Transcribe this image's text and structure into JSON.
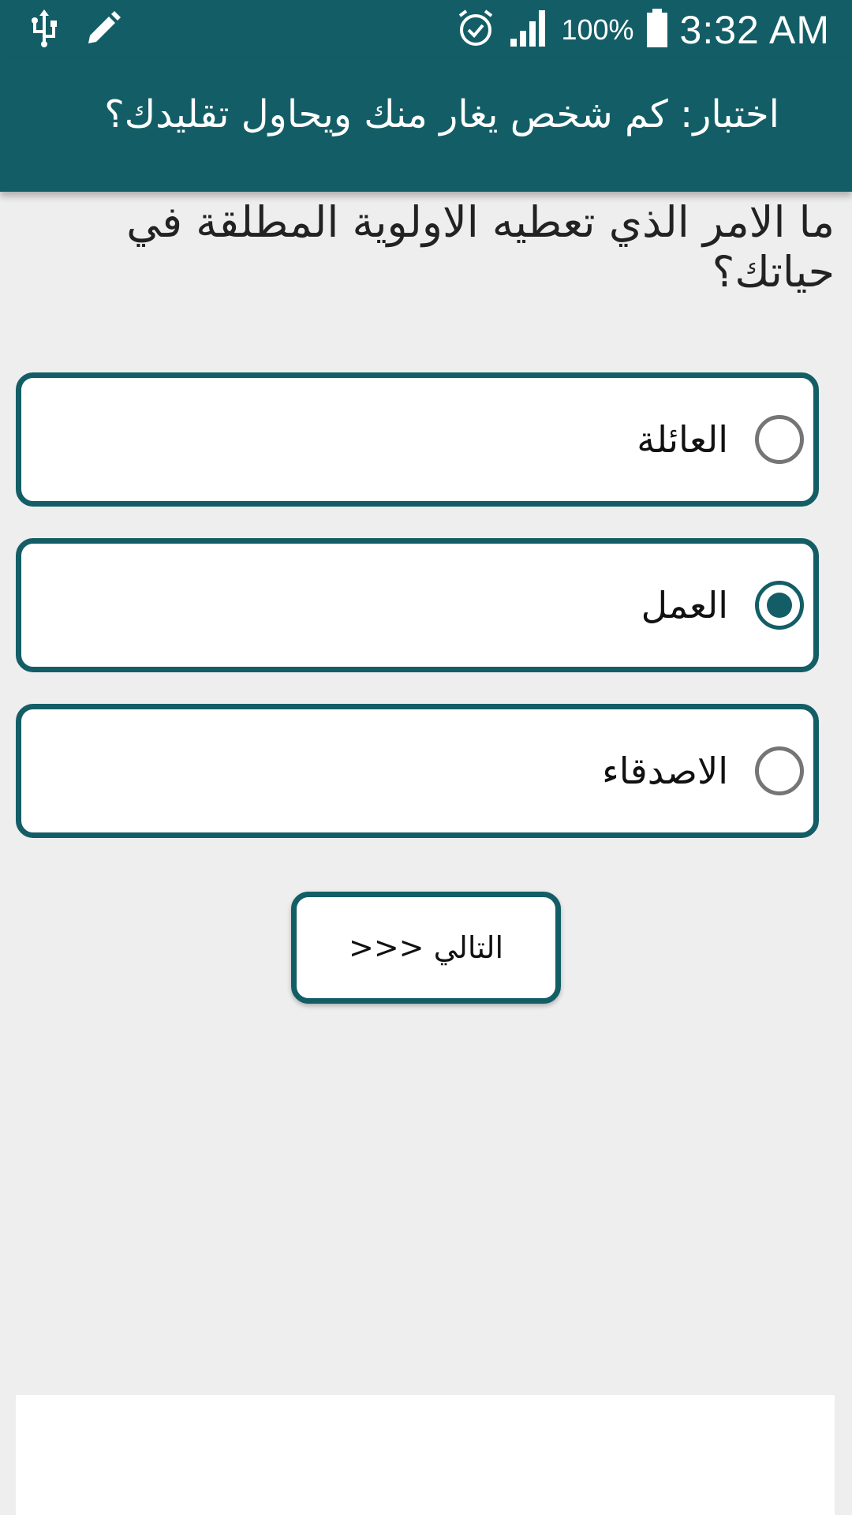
{
  "status_bar": {
    "icons_left": [
      "usb-icon",
      "edit-icon"
    ],
    "icons_right": [
      "alarm-icon",
      "signal-icon"
    ],
    "battery": "100%",
    "time": "3:32 AM"
  },
  "toolbar": {
    "title": "اختبار: كم شخص يغار منك ويحاول تقليدك؟"
  },
  "quiz": {
    "question": "ما الامر الذي تعطيه الاولوية المطلقة في حياتك؟",
    "options": [
      {
        "label": "العائلة",
        "selected": false
      },
      {
        "label": "العمل",
        "selected": true
      },
      {
        "label": "الاصدقاء",
        "selected": false
      }
    ],
    "next_label": "التالي <<<"
  },
  "colors": {
    "primary": "#135E66",
    "background": "#EEEEEE",
    "card": "#FFFFFF"
  }
}
